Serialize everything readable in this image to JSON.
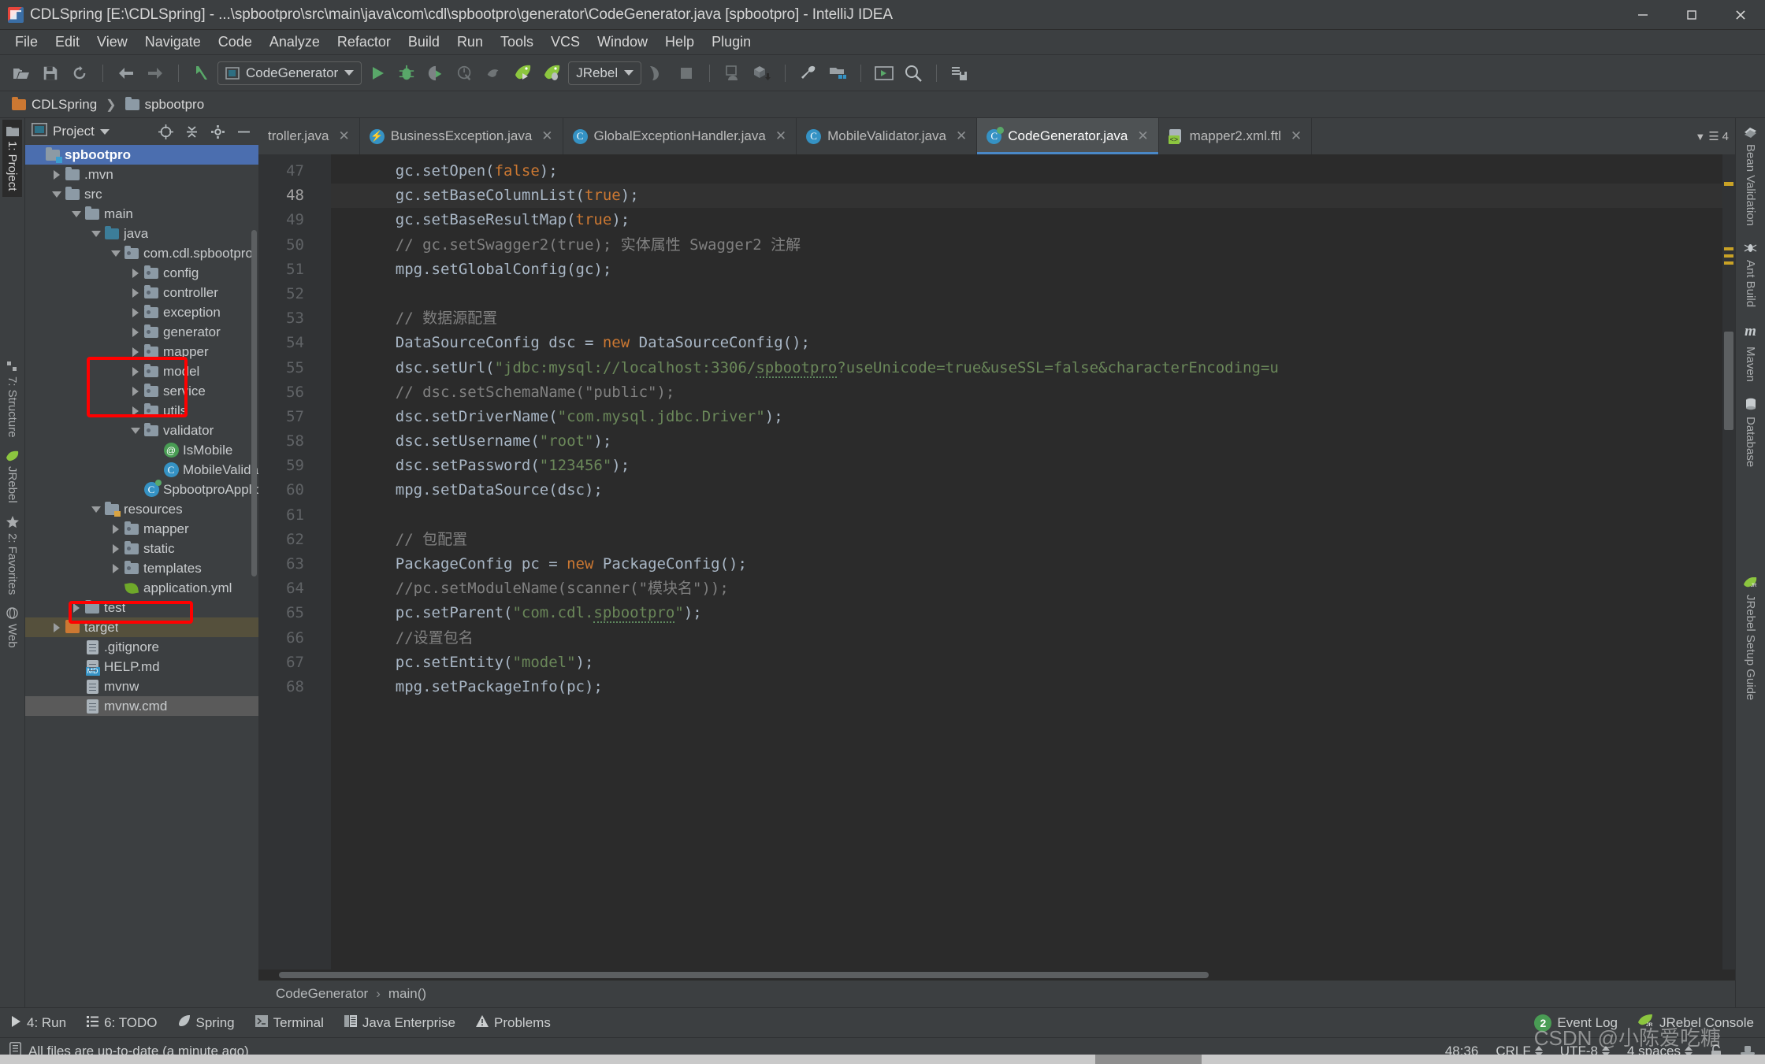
{
  "window": {
    "title": "CDLSpring [E:\\CDLSpring] - ...\\spbootpro\\src\\main\\java\\com\\cdl\\spbootpro\\generator\\CodeGenerator.java [spbootpro] - IntelliJ IDEA",
    "minimize": "—",
    "maximize": "❐",
    "close": "✕"
  },
  "menu": [
    "File",
    "Edit",
    "View",
    "Navigate",
    "Code",
    "Analyze",
    "Refactor",
    "Build",
    "Run",
    "Tools",
    "VCS",
    "Window",
    "Help",
    "Plugin"
  ],
  "toolbar": {
    "open_label": "open-project",
    "save_label": "save-all",
    "sync_label": "sync",
    "back_label": "back",
    "forward_label": "forward",
    "run_config": "CodeGenerator",
    "jrebel_config": "JRebel"
  },
  "breadcrumb": {
    "project": "CDLSpring",
    "module": "spbootpro"
  },
  "left_strip": [
    "1: Project",
    "7: Structure",
    "JRebel",
    "2: Favorites",
    "Web"
  ],
  "right_strip": [
    "Bean Validation",
    "Ant Build",
    "Maven",
    "Database",
    "JRebel Setup Guide"
  ],
  "project_panel": {
    "title": "Project",
    "tree": [
      {
        "label": "spbootpro",
        "indent": 0,
        "twist": "none",
        "icon": "folder-module",
        "state": "selected"
      },
      {
        "label": ".mvn",
        "indent": 1,
        "twist": "closed",
        "icon": "folder",
        "state": ""
      },
      {
        "label": "src",
        "indent": 1,
        "twist": "open",
        "icon": "folder",
        "state": ""
      },
      {
        "label": "main",
        "indent": 2,
        "twist": "open",
        "icon": "folder",
        "state": ""
      },
      {
        "label": "java",
        "indent": 3,
        "twist": "open",
        "icon": "folder-source",
        "state": ""
      },
      {
        "label": "com.cdl.spbootpro",
        "indent": 4,
        "twist": "open",
        "icon": "folder-package",
        "state": ""
      },
      {
        "label": "config",
        "indent": 5,
        "twist": "closed",
        "icon": "folder-package",
        "state": ""
      },
      {
        "label": "controller",
        "indent": 5,
        "twist": "closed",
        "icon": "folder-package",
        "state": ""
      },
      {
        "label": "exception",
        "indent": 5,
        "twist": "closed",
        "icon": "folder-package",
        "state": ""
      },
      {
        "label": "generator",
        "indent": 5,
        "twist": "closed",
        "icon": "folder-package",
        "state": ""
      },
      {
        "label": "mapper",
        "indent": 5,
        "twist": "closed",
        "icon": "folder-package",
        "state": ""
      },
      {
        "label": "model",
        "indent": 5,
        "twist": "closed",
        "icon": "folder-package",
        "state": ""
      },
      {
        "label": "service",
        "indent": 5,
        "twist": "closed",
        "icon": "folder-package",
        "state": ""
      },
      {
        "label": "utils",
        "indent": 5,
        "twist": "closed",
        "icon": "folder-package",
        "state": ""
      },
      {
        "label": "validator",
        "indent": 5,
        "twist": "open",
        "icon": "folder-package",
        "state": ""
      },
      {
        "label": "IsMobile",
        "indent": 6,
        "twist": "none",
        "icon": "annotation",
        "state": ""
      },
      {
        "label": "MobileValidator",
        "indent": 6,
        "twist": "none",
        "icon": "class",
        "state": ""
      },
      {
        "label": "SpbootproApplicati",
        "indent": 5,
        "twist": "none",
        "icon": "spring-class",
        "state": ""
      },
      {
        "label": "resources",
        "indent": 3,
        "twist": "open",
        "icon": "folder-resource",
        "state": ""
      },
      {
        "label": "mapper",
        "indent": 4,
        "twist": "closed",
        "icon": "folder-package",
        "state": ""
      },
      {
        "label": "static",
        "indent": 4,
        "twist": "closed",
        "icon": "folder-package",
        "state": ""
      },
      {
        "label": "templates",
        "indent": 4,
        "twist": "closed",
        "icon": "folder-package",
        "state": ""
      },
      {
        "label": "application.yml",
        "indent": 4,
        "twist": "none",
        "icon": "spring-yml",
        "state": ""
      },
      {
        "label": "test",
        "indent": 2,
        "twist": "closed",
        "icon": "folder",
        "state": ""
      },
      {
        "label": "target",
        "indent": 1,
        "twist": "closed",
        "icon": "folder-orange",
        "state": "target"
      },
      {
        "label": ".gitignore",
        "indent": 2,
        "twist": "none",
        "icon": "file",
        "state": ""
      },
      {
        "label": "HELP.md",
        "indent": 2,
        "twist": "none",
        "icon": "file-md",
        "state": ""
      },
      {
        "label": "mvnw",
        "indent": 2,
        "twist": "none",
        "icon": "file",
        "state": ""
      },
      {
        "label": "mvnw.cmd",
        "indent": 2,
        "twist": "none",
        "icon": "file",
        "state": "grey"
      }
    ]
  },
  "editor_tabs": [
    {
      "label": "troller.java",
      "icon": "class",
      "active": false,
      "truncated": true
    },
    {
      "label": "BusinessException.java",
      "icon": "exception",
      "active": false,
      "truncated": false
    },
    {
      "label": "GlobalExceptionHandler.java",
      "icon": "class",
      "active": false,
      "truncated": false
    },
    {
      "label": "MobileValidator.java",
      "icon": "class",
      "active": false,
      "truncated": false
    },
    {
      "label": "CodeGenerator.java",
      "icon": "spring-class",
      "active": true,
      "truncated": false
    },
    {
      "label": "mapper2.xml.ftl",
      "icon": "ftl",
      "active": false,
      "truncated": false
    }
  ],
  "tabs_overflow": "4",
  "code": {
    "first_line": 47,
    "current_line": 48,
    "lines": [
      {
        "n": 47,
        "tokens": [
          {
            "t": "plain",
            "v": "    gc.setOpen("
          },
          {
            "t": "kw",
            "v": "false"
          },
          {
            "t": "plain",
            "v": ");"
          }
        ]
      },
      {
        "n": 48,
        "tokens": [
          {
            "t": "plain",
            "v": "    gc.setBaseColumnList("
          },
          {
            "t": "kw",
            "v": "true"
          },
          {
            "t": "plain",
            "v": ");"
          }
        ]
      },
      {
        "n": 49,
        "tokens": [
          {
            "t": "plain",
            "v": "    gc.setBaseResultMap("
          },
          {
            "t": "kw",
            "v": "true"
          },
          {
            "t": "plain",
            "v": ");"
          }
        ]
      },
      {
        "n": 50,
        "tokens": [
          {
            "t": "cmt",
            "v": "    // gc.setSwagger2(true); 实体属性 Swagger2 注解"
          }
        ]
      },
      {
        "n": 51,
        "tokens": [
          {
            "t": "plain",
            "v": "    mpg.setGlobalConfig(gc);"
          }
        ]
      },
      {
        "n": 52,
        "tokens": [
          {
            "t": "plain",
            "v": ""
          }
        ]
      },
      {
        "n": 53,
        "tokens": [
          {
            "t": "cmt",
            "v": "    // 数据源配置"
          }
        ]
      },
      {
        "n": 54,
        "tokens": [
          {
            "t": "plain",
            "v": "    DataSourceConfig dsc = "
          },
          {
            "t": "kw",
            "v": "new"
          },
          {
            "t": "plain",
            "v": " DataSourceConfig();"
          }
        ]
      },
      {
        "n": 55,
        "tokens": [
          {
            "t": "plain",
            "v": "    dsc.setUrl("
          },
          {
            "t": "str",
            "v": "\"jdbc:mysql://localhost:3306/"
          },
          {
            "t": "str-squig",
            "v": "spbootpro"
          },
          {
            "t": "str",
            "v": "?useUnicode=true&useSSL=false&characterEncoding=u"
          }
        ]
      },
      {
        "n": 56,
        "tokens": [
          {
            "t": "cmt",
            "v": "    // dsc.setSchemaName(\"public\");"
          }
        ]
      },
      {
        "n": 57,
        "tokens": [
          {
            "t": "plain",
            "v": "    dsc.setDriverName("
          },
          {
            "t": "str",
            "v": "\"com.mysql.jdbc.Driver\""
          },
          {
            "t": "plain",
            "v": ");"
          }
        ]
      },
      {
        "n": 58,
        "tokens": [
          {
            "t": "plain",
            "v": "    dsc.setUsername("
          },
          {
            "t": "str",
            "v": "\"root\""
          },
          {
            "t": "plain",
            "v": ");"
          }
        ]
      },
      {
        "n": 59,
        "tokens": [
          {
            "t": "plain",
            "v": "    dsc.setPassword("
          },
          {
            "t": "str",
            "v": "\"123456\""
          },
          {
            "t": "plain",
            "v": ");"
          }
        ]
      },
      {
        "n": 60,
        "tokens": [
          {
            "t": "plain",
            "v": "    mpg.setDataSource(dsc);"
          }
        ]
      },
      {
        "n": 61,
        "tokens": [
          {
            "t": "plain",
            "v": ""
          }
        ]
      },
      {
        "n": 62,
        "tokens": [
          {
            "t": "cmt",
            "v": "    // 包配置"
          }
        ]
      },
      {
        "n": 63,
        "tokens": [
          {
            "t": "plain",
            "v": "    PackageConfig pc = "
          },
          {
            "t": "kw",
            "v": "new"
          },
          {
            "t": "plain",
            "v": " PackageConfig();"
          }
        ]
      },
      {
        "n": 64,
        "tokens": [
          {
            "t": "cmt",
            "v": "    //pc.setModuleName(scanner(\"模块名\"));"
          }
        ]
      },
      {
        "n": 65,
        "tokens": [
          {
            "t": "plain",
            "v": "    pc.setParent("
          },
          {
            "t": "str",
            "v": "\"com.cdl."
          },
          {
            "t": "str-squig",
            "v": "spbootpro"
          },
          {
            "t": "str",
            "v": "\""
          },
          {
            "t": "plain",
            "v": ");"
          }
        ]
      },
      {
        "n": 66,
        "tokens": [
          {
            "t": "cmt",
            "v": "    //设置包名"
          }
        ]
      },
      {
        "n": 67,
        "tokens": [
          {
            "t": "plain",
            "v": "    pc.setEntity("
          },
          {
            "t": "str",
            "v": "\"model\""
          },
          {
            "t": "plain",
            "v": ");"
          }
        ]
      },
      {
        "n": 68,
        "tokens": [
          {
            "t": "plain",
            "v": "    mpg.setPackageInfo(pc);"
          }
        ]
      }
    ]
  },
  "editor_breadcrumb": {
    "class": "CodeGenerator",
    "sep": "›",
    "method": "main()"
  },
  "bottom_bar": {
    "left": [
      {
        "label": "4: Run",
        "icon": "run-icon"
      },
      {
        "label": "6: TODO",
        "icon": "todo-icon"
      },
      {
        "label": "Spring",
        "icon": "spring-icon"
      },
      {
        "label": "Terminal",
        "icon": "terminal-icon"
      },
      {
        "label": "Java Enterprise",
        "icon": "java-enterprise-icon"
      },
      {
        "label": "Problems",
        "icon": "warning-icon"
      }
    ],
    "right": [
      {
        "label": "Event Log",
        "icon": "event-log-icon",
        "badge": "2"
      },
      {
        "label": "JRebel Console",
        "icon": "jrebel-icon",
        "badge": ""
      }
    ]
  },
  "status_bar": {
    "message": "All files are up-to-date (a minute ago)",
    "caret": "48:36",
    "line_sep": "CRLF",
    "encoding": "UTF-8",
    "indent": "4 spaces"
  },
  "watermark": "CSDN @小陈爱吃糖",
  "annotations": {
    "box1_label": "mapper-model-service-highlight",
    "box2_label": "resources-mapper-highlight"
  },
  "colors": {
    "accent": "#4b6eaf",
    "annotation": "#ff0000",
    "keyword": "#cc7832",
    "string": "#6a8759",
    "comment": "#808080",
    "editor_bg": "#2b2b2b",
    "panel_bg": "#3c3f41"
  }
}
